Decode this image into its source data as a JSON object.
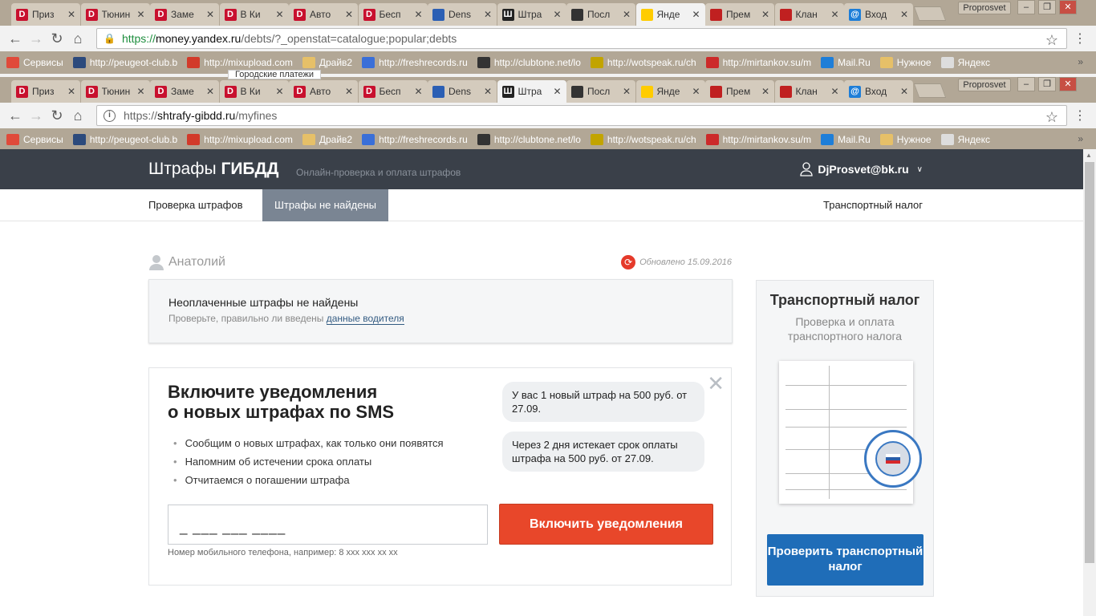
{
  "browser": {
    "tabs": [
      {
        "title": "Приз",
        "icon": "d-icon",
        "color": "#c8102e"
      },
      {
        "title": "Тюнин",
        "icon": "d-icon",
        "color": "#c8102e"
      },
      {
        "title": "Заме",
        "icon": "d-icon",
        "color": "#c8102e"
      },
      {
        "title": "В Ки",
        "icon": "d-icon",
        "color": "#c8102e"
      },
      {
        "title": "Авто",
        "icon": "d-icon",
        "color": "#c8102e"
      },
      {
        "title": "Бесп",
        "icon": "d-icon",
        "color": "#c8102e"
      },
      {
        "title": "Dens",
        "icon": "globe-icon",
        "color": "#2b5fb4"
      },
      {
        "title": "Штра",
        "icon": "w-icon",
        "color": "#222222"
      },
      {
        "title": "Посл",
        "icon": "face-icon",
        "color": "#333333"
      },
      {
        "title": "Янде",
        "icon": "ya-icon",
        "color": "#ffcc00"
      },
      {
        "title": "Прем",
        "icon": "circle-icon",
        "color": "#c02020"
      },
      {
        "title": "Клан",
        "icon": "circle-icon",
        "color": "#c02020"
      },
      {
        "title": "Вход",
        "icon": "at-icon",
        "color": "#1e7ed8"
      }
    ],
    "profile": "Proprosvet",
    "url1_scheme": "https://",
    "url1_host": "money.yandex.ru",
    "url1_path": "/debts/?_openstat=catalogue;popular;debts",
    "url2_scheme": "https://",
    "url2_host": "shtrafy-gibdd.ru",
    "url2_path": "/myfines",
    "bookmarks": [
      {
        "label": "Сервисы",
        "color": "#e04a3a"
      },
      {
        "label": "http://peugeot-club.b",
        "color": "#2c4a7c"
      },
      {
        "label": "http://mixupload.com",
        "color": "#d23a2a"
      },
      {
        "label": "Драйв2",
        "color": "#e6c068"
      },
      {
        "label": "http://freshrecords.ru",
        "color": "#3a6fd8"
      },
      {
        "label": "http://clubtone.net/lo",
        "color": "#333333"
      },
      {
        "label": "http://wotspeak.ru/ch",
        "color": "#c2a400"
      },
      {
        "label": "http://mirtankov.su/m",
        "color": "#cc2a2a"
      },
      {
        "label": "Mail.Ru",
        "color": "#1e7ed8"
      },
      {
        "label": "Нужное",
        "color": "#e6c068"
      },
      {
        "label": "Яндекс",
        "color": "#dddddd"
      }
    ],
    "tooltip": "Городские платежи"
  },
  "site": {
    "logo_light": "Штрафы ",
    "logo_bold": "ГИБДД",
    "tagline": "Онлайн-проверка и оплата штрафов",
    "user_email": "DjProsvet@bk.ru",
    "nav_check": "Проверка штрафов",
    "nav_active": "Штрафы не найдены",
    "nav_tax": "Транспортный налог",
    "driver_name": "Анатолий",
    "updated": "Обновлено 15.09.2016",
    "nofines_title": "Неоплаченные штрафы не найдены",
    "nofines_text": "Проверьте, правильно ли введены ",
    "nofines_link": "данные водителя",
    "sms_title_1": "Включите уведомления",
    "sms_title_2": "о новых штрафах по SMS",
    "sms_points": [
      "Сообщим о новых штрафах, как только они появятся",
      "Напомним об истечении срока оплаты",
      "Отчитаемся о погашении штрафа"
    ],
    "bubble_1": "У вас 1 новый штраф на 500 руб. от 27.09.",
    "bubble_2": "Через 2 дня истекает срок оплаты штрафа на 500 руб. от 27.09.",
    "phone_mask": "_ ___ ___ ____",
    "phone_hint": "Номер мобильного телефона, например: 8 xxx xxx xx xx",
    "enable_button": "Включить уведомления",
    "tax_title": "Транспортный налог",
    "tax_subtitle": "Проверка и оплата транспортного налога",
    "tax_button": "Проверить транспортный налог"
  }
}
